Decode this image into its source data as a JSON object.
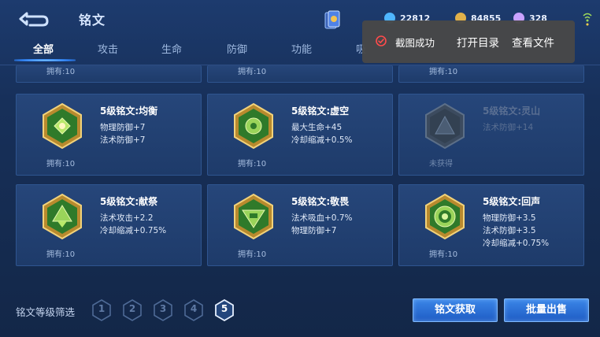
{
  "header": {
    "title": "铭文",
    "currencies": [
      {
        "value": "22812",
        "icon": "diamond-icon",
        "color": "#4fb6ff"
      },
      {
        "value": "84855",
        "icon": "gold-coin-icon",
        "color": "#e0b04a"
      },
      {
        "value": "328",
        "icon": "gem-icon",
        "color": "#c9a2ff"
      }
    ]
  },
  "tabs": [
    {
      "label": "全部",
      "active": true
    },
    {
      "label": "攻击"
    },
    {
      "label": "生命"
    },
    {
      "label": "防御"
    },
    {
      "label": "功能"
    },
    {
      "label": "吸"
    }
  ],
  "partial_row": [
    {
      "owned": "拥有:10"
    },
    {
      "owned": "拥有:10"
    },
    {
      "owned": "拥有:10"
    }
  ],
  "cards": [
    {
      "name": "5级铭文:均衡",
      "stats": [
        "物理防御+7",
        "法术防御+7"
      ],
      "owned": "拥有:10",
      "locked": false
    },
    {
      "name": "5级铭文:虚空",
      "stats": [
        "最大生命+45",
        "冷却缩减+0.5%"
      ],
      "owned": "拥有:10",
      "locked": false
    },
    {
      "name": "5级铭文:灵山",
      "stats": [
        "法术防御+14"
      ],
      "owned": "未获得",
      "locked": true
    },
    {
      "name": "5级铭文:献祭",
      "stats": [
        "法术攻击+2.2",
        "冷却缩减+0.75%"
      ],
      "owned": "拥有:10",
      "locked": false
    },
    {
      "name": "5级铭文:敬畏",
      "stats": [
        "法术吸血+0.7%",
        "物理防御+7"
      ],
      "owned": "拥有:10",
      "locked": false
    },
    {
      "name": "5级铭文:回声",
      "stats": [
        "物理防御+3.5",
        "法术防御+3.5",
        "冷却缩减+0.75%"
      ],
      "owned": "拥有:10",
      "locked": false
    }
  ],
  "filter": {
    "label": "铭文等级筛选",
    "levels": [
      "1",
      "2",
      "3",
      "4",
      "5"
    ],
    "selected": "5"
  },
  "buttons": {
    "acquire": "铭文获取",
    "bulk_sell": "批量出售"
  },
  "toast": {
    "message": "截图成功",
    "action_open_dir": "打开目录",
    "action_view_file": "查看文件"
  }
}
